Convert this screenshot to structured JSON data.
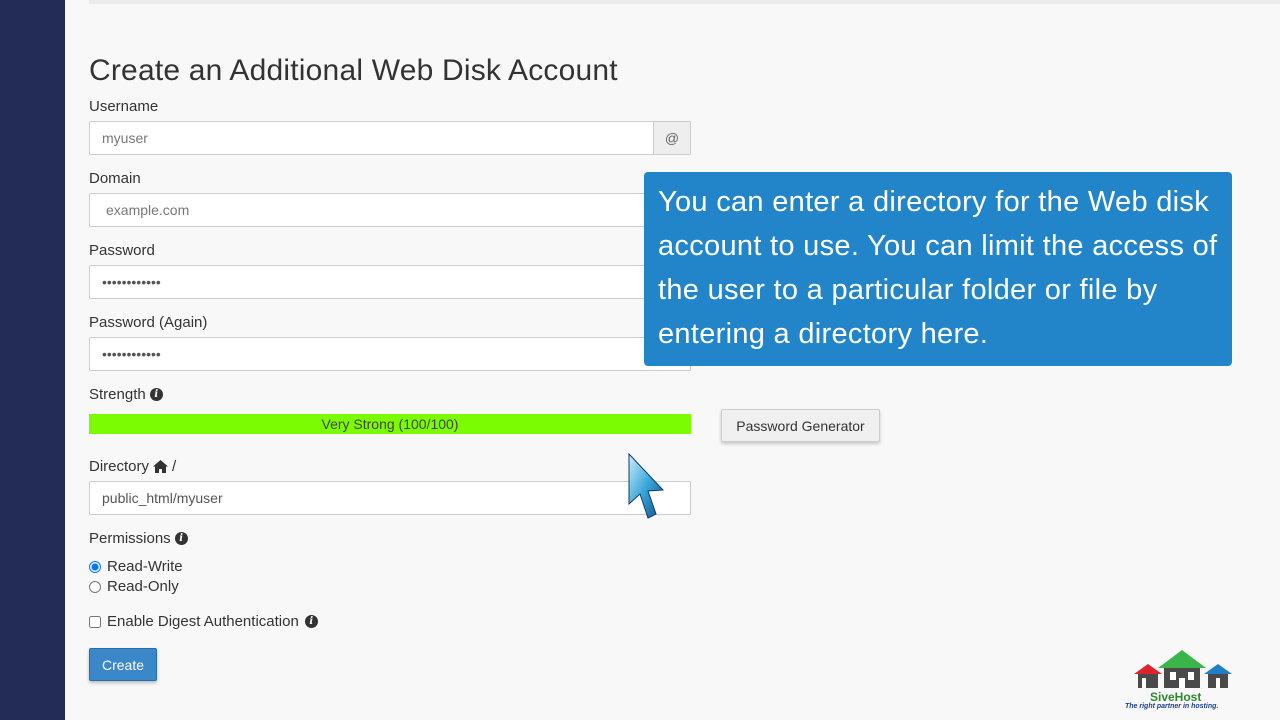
{
  "form": {
    "title": "Create an Additional Web Disk Account",
    "username": {
      "label": "Username",
      "placeholder": "myuser",
      "addon": "@"
    },
    "domain": {
      "label": "Domain",
      "placeholder": "example.com"
    },
    "password": {
      "label": "Password",
      "value": "••••••••••••"
    },
    "password_again": {
      "label": "Password (Again)",
      "value": "••••••••••••"
    },
    "strength": {
      "label": "Strength",
      "text": "Very Strong (100/100)",
      "score": 100
    },
    "password_generator": "Password Generator",
    "directory": {
      "label": "Directory",
      "separator": "/",
      "value": "public_html/myuser"
    },
    "permissions": {
      "label": "Permissions",
      "options": [
        "Read-Write",
        "Read-Only"
      ],
      "selected": "Read-Write"
    },
    "digest": {
      "label": "Enable Digest Authentication",
      "checked": false
    },
    "create": "Create"
  },
  "tooltip": {
    "text": "You can enter a directory for the Web disk account to use. You can limit the access of the user to a particular folder or file by entering a directory here."
  },
  "logo": {
    "name": "SiveHost",
    "tagline": "The right partner in hosting."
  },
  "colors": {
    "sidebar": "#232c57",
    "tooltip": "#2385c9",
    "strength_bar": "#7cfc00",
    "create_button": "#3a88c9"
  }
}
